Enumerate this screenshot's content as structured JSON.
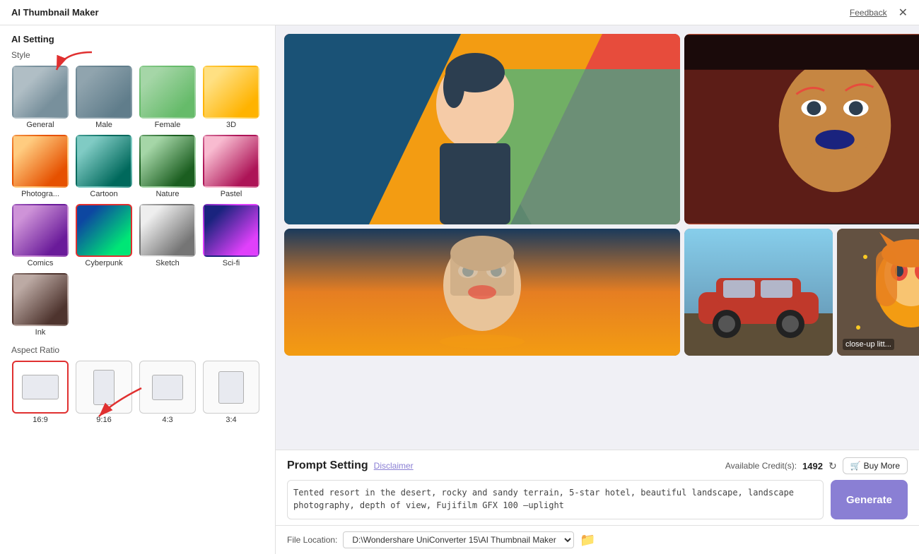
{
  "titleBar": {
    "title": "AI Thumbnail Maker",
    "feedback": "Feedback",
    "close": "✕"
  },
  "leftPanel": {
    "aiSetting": "AI Setting",
    "styleLabel": "Style",
    "styles": [
      {
        "id": "general",
        "label": "General",
        "selected": false,
        "thumb": "thumb-general"
      },
      {
        "id": "male",
        "label": "Male",
        "selected": false,
        "thumb": "thumb-male"
      },
      {
        "id": "female",
        "label": "Female",
        "selected": false,
        "thumb": "thumb-female"
      },
      {
        "id": "3d",
        "label": "3D",
        "selected": false,
        "thumb": "thumb-3d"
      },
      {
        "id": "photo",
        "label": "Photogra...",
        "selected": false,
        "thumb": "thumb-photo"
      },
      {
        "id": "cartoon",
        "label": "Cartoon",
        "selected": false,
        "thumb": "thumb-cartoon"
      },
      {
        "id": "nature",
        "label": "Nature",
        "selected": false,
        "thumb": "thumb-nature"
      },
      {
        "id": "pastel",
        "label": "Pastel",
        "selected": false,
        "thumb": "thumb-pastel"
      },
      {
        "id": "comics",
        "label": "Comics",
        "selected": false,
        "thumb": "thumb-comics"
      },
      {
        "id": "cyberpunk",
        "label": "Cyberpunk",
        "selected": true,
        "thumb": "thumb-cyberpunk"
      },
      {
        "id": "sketch",
        "label": "Sketch",
        "selected": false,
        "thumb": "thumb-sketch"
      },
      {
        "id": "scifi",
        "label": "Sci-fi",
        "selected": false,
        "thumb": "thumb-scifi"
      },
      {
        "id": "ink",
        "label": "Ink",
        "selected": false,
        "thumb": "thumb-ink"
      }
    ],
    "aspectRatioLabel": "Aspect Ratio",
    "aspectRatios": [
      {
        "id": "16-9",
        "label": "16:9",
        "selected": true
      },
      {
        "id": "9-16",
        "label": "9:16",
        "selected": false
      },
      {
        "id": "4-3",
        "label": "4:3",
        "selected": false
      },
      {
        "id": "3-4",
        "label": "3:4",
        "selected": false
      }
    ]
  },
  "gallery": {
    "images": [
      {
        "id": "main-man",
        "type": "large",
        "desc": "Young man with colorful background"
      },
      {
        "id": "face",
        "type": "top-right",
        "desc": "Woman face close up"
      },
      {
        "id": "girl-sunset",
        "type": "bottom-left",
        "desc": "Girl at sunset"
      },
      {
        "id": "car",
        "type": "bottom-mid",
        "desc": "Red classic car"
      },
      {
        "id": "anime",
        "type": "bottom-right",
        "desc": "close-up litt...",
        "hasAdd": true
      }
    ]
  },
  "prompt": {
    "title": "Prompt Setting",
    "disclaimer": "Disclaimer",
    "creditsLabel": "Available Credit(s):",
    "creditsCount": "1492",
    "buyMoreLabel": "Buy More",
    "textValue": "Tented resort in the desert, rocky and sandy terrain, 5-star hotel, beautiful landscape, landscape photography, depth of view, Fujifilm GFX 100 –uplight",
    "generateLabel": "Generate"
  },
  "fileLocation": {
    "label": "File Location:",
    "path": "D:\\Wondershare UniConverter 15\\AI Thumbnail Maker",
    "folderIcon": "📁"
  }
}
